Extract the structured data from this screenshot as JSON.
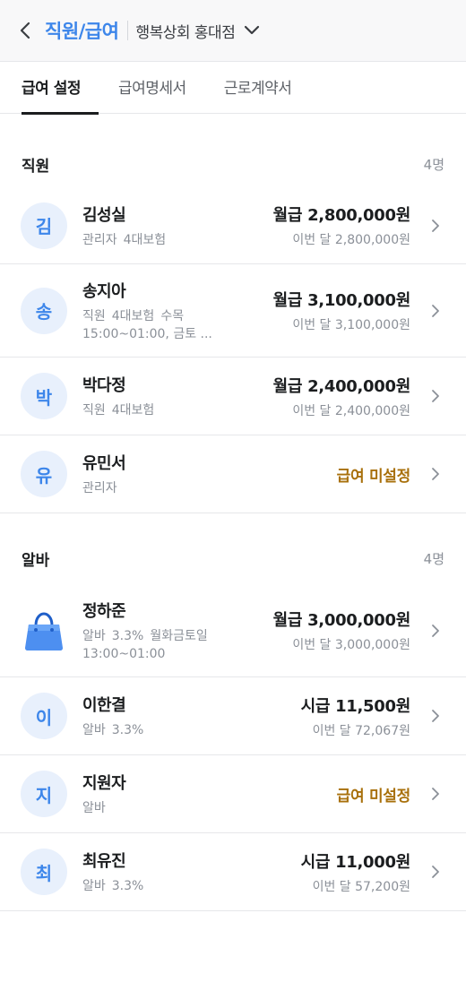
{
  "header": {
    "title": "직원/급여",
    "store": "행복상회 홍대점"
  },
  "tabs": [
    {
      "label": "급여 설정",
      "active": true
    },
    {
      "label": "급여명세서",
      "active": false
    },
    {
      "label": "근로계약서",
      "active": false
    }
  ],
  "staff": {
    "title": "직원",
    "count": "4명",
    "rows": [
      {
        "avatar": "김",
        "name": "김성실",
        "meta": [
          "관리자",
          "4대보험"
        ],
        "meta2": "",
        "pay_main": "월급 2,800,000원",
        "pay_sub": "이번 달 2,800,000원"
      },
      {
        "avatar": "송",
        "name": "송지아",
        "meta": [
          "직원",
          "4대보험",
          "수목"
        ],
        "meta2": "15:00~01:00, 금토 ...",
        "pay_main": "월급 3,100,000원",
        "pay_sub": "이번 달 3,100,000원"
      },
      {
        "avatar": "박",
        "name": "박다정",
        "meta": [
          "직원",
          "4대보험"
        ],
        "meta2": "",
        "pay_main": "월급 2,400,000원",
        "pay_sub": "이번 달 2,400,000원"
      },
      {
        "avatar": "유",
        "name": "유민서",
        "meta": [
          "관리자"
        ],
        "meta2": "",
        "pay_unset": "급여 미설정"
      }
    ]
  },
  "parttime": {
    "title": "알바",
    "count": "4명",
    "rows": [
      {
        "avatar_icon": "shopping-bag-icon",
        "name": "정하준",
        "meta": [
          "알바",
          "3.3%",
          "월화금토일"
        ],
        "meta2": "13:00~01:00",
        "pay_main": "월급 3,000,000원",
        "pay_sub": "이번 달 3,000,000원"
      },
      {
        "avatar": "이",
        "name": "이한결",
        "meta": [
          "알바",
          "3.3%"
        ],
        "meta2": "",
        "pay_main": "시급 11,500원",
        "pay_sub": "이번 달 72,067원"
      },
      {
        "avatar": "지",
        "name": "지원자",
        "meta": [
          "알바"
        ],
        "meta2": "",
        "pay_unset": "급여 미설정"
      },
      {
        "avatar": "최",
        "name": "최유진",
        "meta": [
          "알바",
          "3.3%"
        ],
        "meta2": "",
        "pay_main": "시급 11,000원",
        "pay_sub": "이번 달 57,200원"
      }
    ]
  },
  "colors": {
    "accent": "#3d86ea",
    "unset": "#a8700b",
    "avatar_bg": "#e8f0fc"
  }
}
